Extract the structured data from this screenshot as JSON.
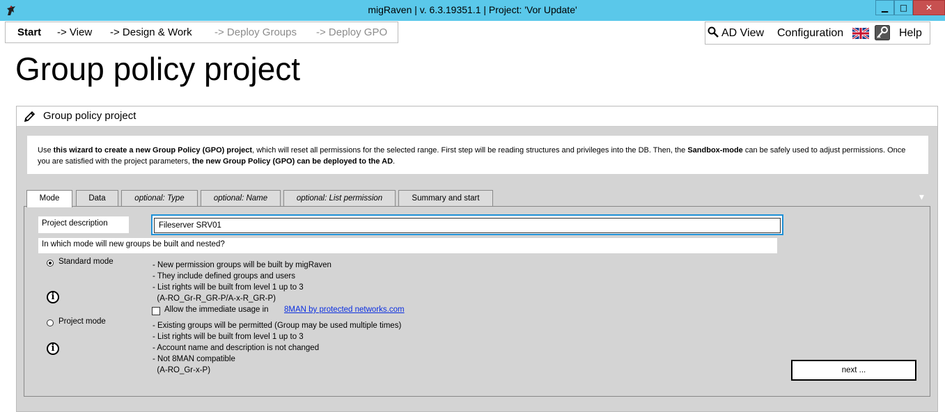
{
  "window": {
    "title": "migRaven | v. 6.3.19351.1 | Project: 'Vor Update'",
    "minimize": "▁",
    "maximize": "□",
    "close": "✕"
  },
  "nav": {
    "items": [
      "Start",
      "-> View",
      "-> Design & Work",
      "-> Deploy Groups",
      "-> Deploy GPO"
    ]
  },
  "right_nav": {
    "ad_view": "AD View",
    "configuration": "Configuration",
    "help": "Help"
  },
  "page": {
    "title": "Group policy project"
  },
  "panel": {
    "header": "Group policy project",
    "info": {
      "p1": "Use ",
      "b1": "this wizard to create a new Group Policy (GPO) project",
      "p2": ", which will reset all permissions for the selected range. First step will be reading structures and privileges into the DB. Then, the ",
      "b2": "Sandbox-mode",
      "p3": " can be safely used to adjust permissions. Once you are satisfied with the project parameters, ",
      "b3": "the new Group Policy (GPO) can be deployed to the AD",
      "p4": "."
    }
  },
  "tabs": [
    "Mode",
    "Data",
    "optional: Type",
    "optional: Name",
    "optional: List permission",
    "Summary and start"
  ],
  "form": {
    "project_description_label": "Project description",
    "project_description_value": "Fileserver SRV01",
    "mode_question": "In which mode will new groups be built and nested?",
    "standard_mode": {
      "label": "Standard mode",
      "selected": true,
      "lines": [
        "- New permission groups will be built by migRaven",
        "- They include defined groups and users",
        "- List rights will be built from level 1 up to 3",
        "  (A-RO_Gr-R_GR-P/A-x-R_GR-P)"
      ],
      "checkbox_label": "Allow the immediate usage in",
      "checkbox_link": "8MAN by protected networks.com",
      "checkbox_checked": false
    },
    "project_mode": {
      "label": "Project mode",
      "selected": false,
      "lines": [
        "- Existing groups will be permitted (Group may be used multiple times)",
        "- List rights will be built from level 1 up to 3",
        "- Account name and description is not changed",
        "- Not 8MAN compatible",
        "  (A-RO_Gr-x-P)"
      ]
    },
    "info_glyph": "i",
    "next_button": "next ..."
  }
}
